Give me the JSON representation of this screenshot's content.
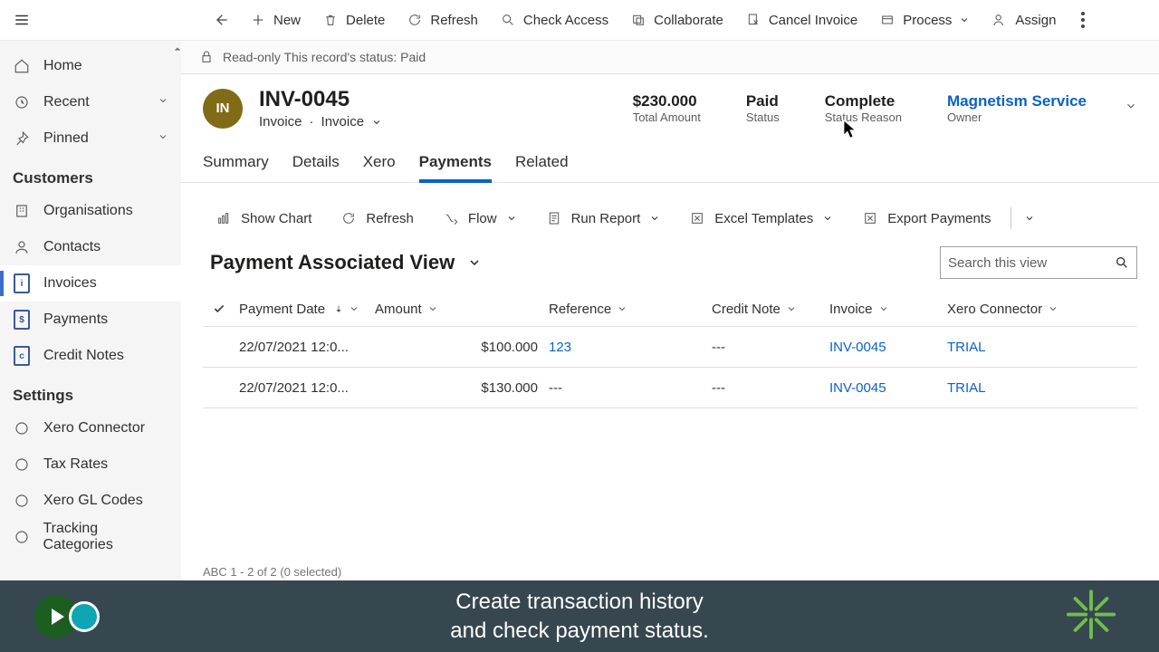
{
  "topbar": {
    "new": "New",
    "delete": "Delete",
    "refresh": "Refresh",
    "check_access": "Check Access",
    "collaborate": "Collaborate",
    "cancel_invoice": "Cancel Invoice",
    "process": "Process",
    "assign": "Assign"
  },
  "sidebar": {
    "home": "Home",
    "recent": "Recent",
    "pinned": "Pinned",
    "section_customers": "Customers",
    "organisations": "Organisations",
    "contacts": "Contacts",
    "invoices": "Invoices",
    "payments": "Payments",
    "credit_notes": "Credit Notes",
    "section_settings": "Settings",
    "xero_connector": "Xero Connector",
    "tax_rates": "Tax Rates",
    "xero_gl_codes": "Xero GL Codes",
    "tracking_categories": "Tracking Categories"
  },
  "banner": {
    "text": "Read-only This record's status: Paid"
  },
  "record": {
    "avatar": "IN",
    "title": "INV-0045",
    "subtitle1": "Invoice",
    "subtitle2": "Invoice",
    "stats": {
      "total_amount_val": "$230.000",
      "total_amount_lbl": "Total Amount",
      "status_val": "Paid",
      "status_lbl": "Status",
      "status_reason_val": "Complete",
      "status_reason_lbl": "Status Reason",
      "owner_val": "Magnetism Service",
      "owner_lbl": "Owner"
    }
  },
  "tabs": {
    "summary": "Summary",
    "details": "Details",
    "xero": "Xero",
    "payments": "Payments",
    "related": "Related"
  },
  "subcmd": {
    "show_chart": "Show Chart",
    "refresh": "Refresh",
    "flow": "Flow",
    "run_report": "Run Report",
    "excel_templates": "Excel Templates",
    "export_payments": "Export Payments"
  },
  "view": {
    "title": "Payment Associated View",
    "search_placeholder": "Search this view"
  },
  "grid": {
    "headers": {
      "payment_date": "Payment Date",
      "amount": "Amount",
      "reference": "Reference",
      "credit_note": "Credit Note",
      "invoice": "Invoice",
      "xero_connector": "Xero Connector"
    },
    "rows": [
      {
        "date": "22/07/2021 12:0...",
        "amount": "$100.000",
        "reference": "123",
        "credit_note": "---",
        "invoice": "INV-0045",
        "xero": "TRIAL"
      },
      {
        "date": "22/07/2021 12:0...",
        "amount": "$130.000",
        "reference": "---",
        "credit_note": "---",
        "invoice": "INV-0045",
        "xero": "TRIAL"
      }
    ],
    "footer": "ABC     1 - 2 of 2 (0 selected)"
  },
  "caption": {
    "line1": "Create transaction history",
    "line2": "and check payment status."
  }
}
